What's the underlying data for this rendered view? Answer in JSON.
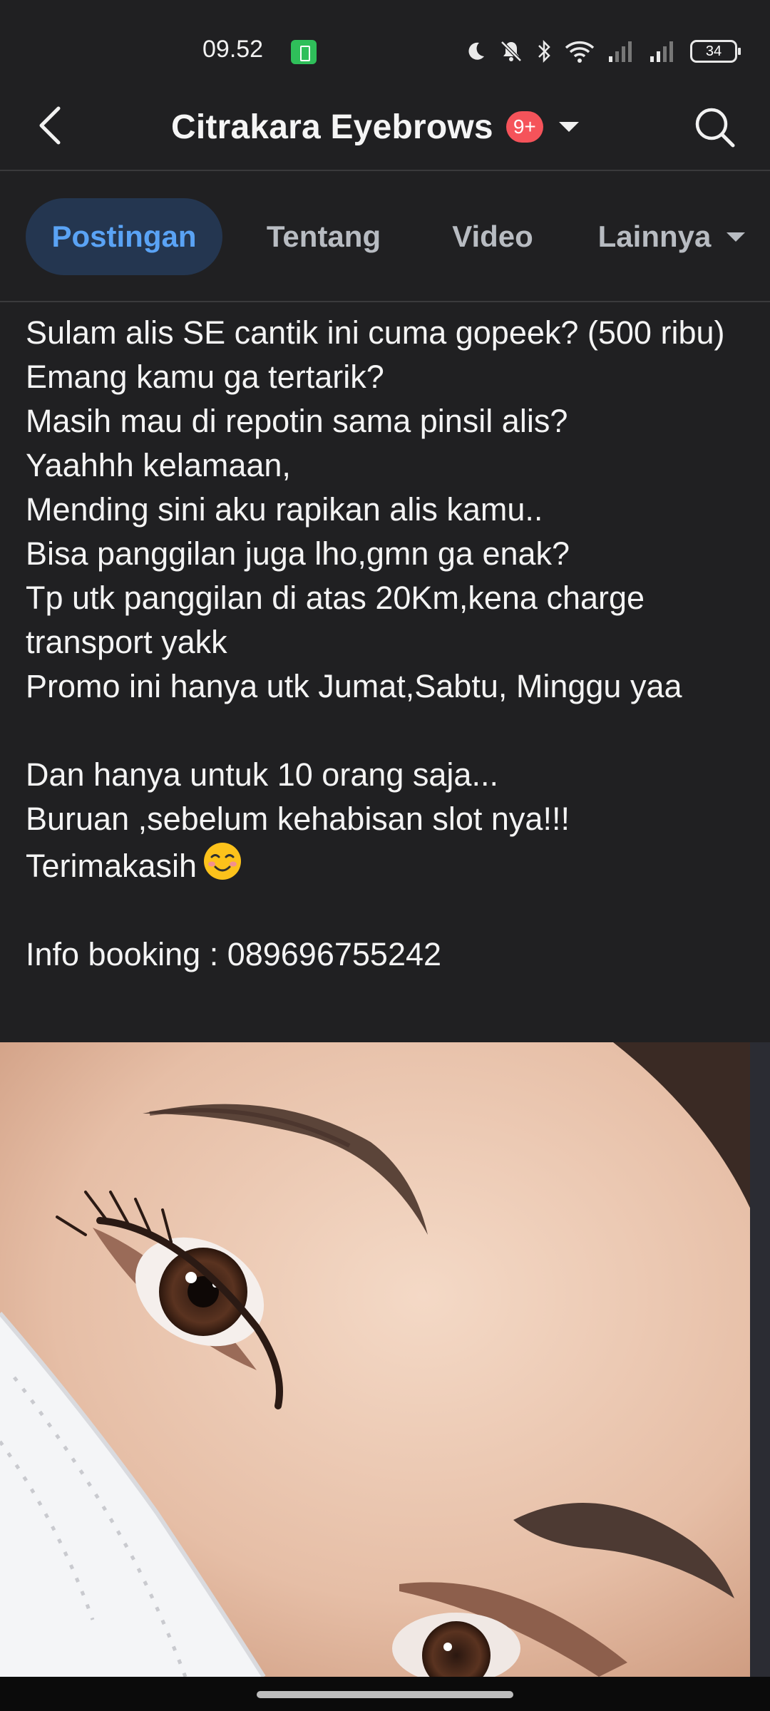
{
  "status_bar": {
    "time": "09.52",
    "battery_level": "34",
    "icons": [
      "battery-saver-icon",
      "moon-icon",
      "mute-icon",
      "bluetooth-icon",
      "wifi-icon",
      "signal-icon",
      "signal-icon"
    ]
  },
  "header": {
    "title": "Citrakara Eyebrows",
    "badge": "9+",
    "back_icon": "chevron-left-icon",
    "search_icon": "search-icon"
  },
  "tabs": [
    {
      "label": "Postingan",
      "active": true
    },
    {
      "label": "Tentang",
      "active": false
    },
    {
      "label": "Video",
      "active": false
    },
    {
      "label": "Lainnya",
      "active": false
    }
  ],
  "post": {
    "lines": [
      "Sulam alis SE cantik ini cuma gopeek? (500 ribu)",
      "Emang kamu ga tertarik?",
      "Masih mau di repotin sama pinsil alis?",
      "Yaahhh kelamaan,",
      "Mending sini aku rapikan alis kamu..",
      "Bisa panggilan juga lho,gmn ga enak?",
      "Tp utk panggilan di atas 20Km,kena charge transport yakk",
      "Promo ini hanya utk Jumat,Sabtu, Minggu yaa",
      "",
      "Dan hanya untuk 10 orang saja...",
      "Buruan ,sebelum kehabisan slot nya!!!",
      "Terimakasih",
      "",
      "Info booking : 089696755242"
    ],
    "emoji": "smiling-face-icon",
    "photo": "eyebrow-closeup-photo"
  },
  "colors": {
    "background": "#202022",
    "active_tab_bg": "#243650",
    "active_tab_text": "#5aa3f5",
    "badge": "#f5535a"
  }
}
